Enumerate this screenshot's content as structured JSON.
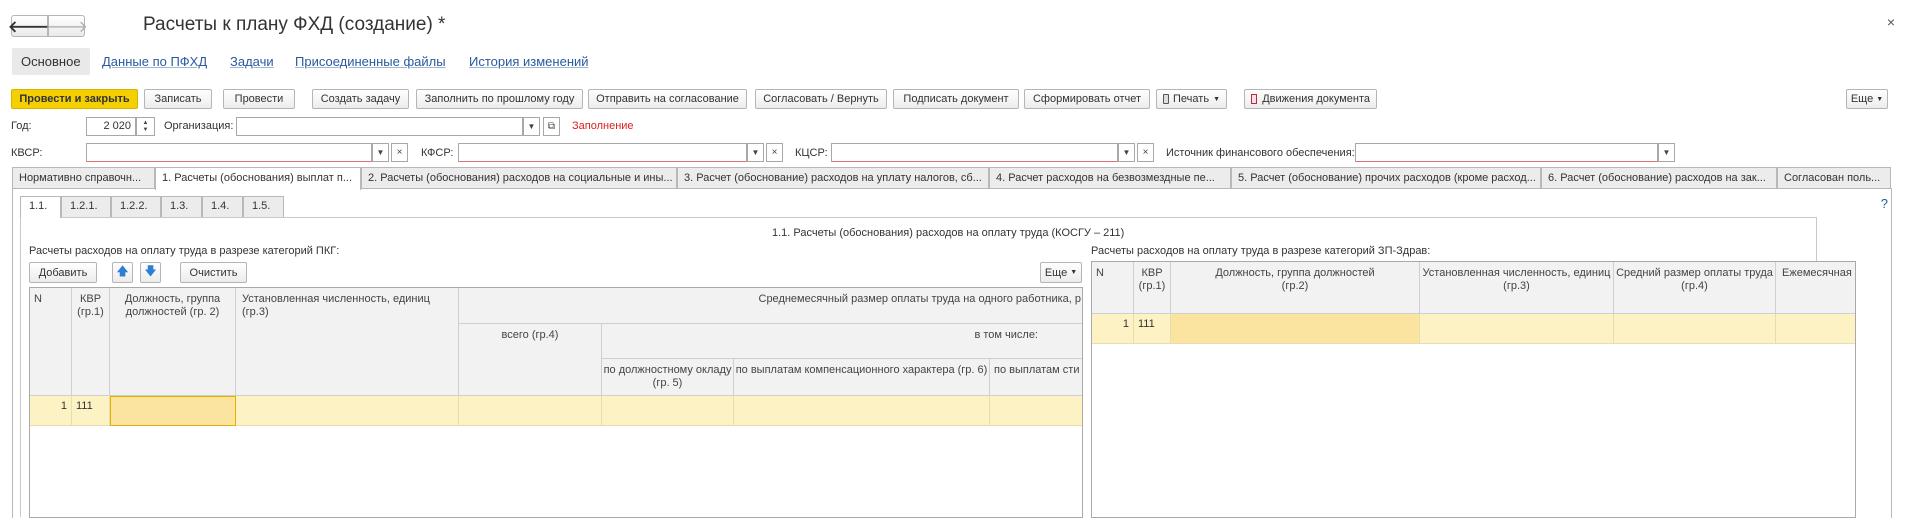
{
  "window": {
    "title": "Расчеты к плану ФХД (создание) *",
    "close_glyph": "×",
    "back_glyph": "🡐",
    "forward_glyph": "🡒"
  },
  "sections": [
    "Основное",
    "Данные по ПФХД",
    "Задачи",
    "Присоединенные файлы",
    "История изменений"
  ],
  "toolbar": {
    "post_close": "Провести и закрыть",
    "save": "Записать",
    "post": "Провести",
    "create_task": "Создать задачу",
    "fill_last_year": "Заполнить по прошлому году",
    "send_approval": "Отправить на согласование",
    "approve_return": "Согласовать / Вернуть",
    "sign": "Подписать документ",
    "report": "Сформировать отчет",
    "print": "Печать",
    "movements": "Движения документа",
    "more": "Еще"
  },
  "form": {
    "year_label": "Год:",
    "year_value": "2 020",
    "org_label": "Организация:",
    "org_value": "",
    "fill_warning": "Заполнение",
    "kvsr_label": "КВСР:",
    "kfsr_label": "КФСР:",
    "kcsr_label": "КЦСР:",
    "source_label": "Источник финансового обеспечения:"
  },
  "tabs": [
    "Нормативно справочн...",
    "1. Расчеты (обоснования) выплат п...",
    "2. Расчеты (обоснования) расходов на социальные и ины...",
    "3. Расчет (обоснование) расходов на уплату налогов, сб...",
    "4. Расчет расходов на безвозмездные пе...",
    "5. Расчет (обоснование) прочих расходов (кроме расход...",
    "6. Расчет (обоснование) расходов на зак...",
    "Согласован поль..."
  ],
  "subtabs": [
    "1.1.",
    "1.2.1.",
    "1.2.2.",
    "1.3.",
    "1.4.",
    "1.5."
  ],
  "help": "?",
  "section_title": "1.1. Расчеты (обоснования) расходов на оплату труда (КОСГУ – 211)",
  "left": {
    "title": "Расчеты расходов на оплату труда в разрезе категорий ПКГ:",
    "add": "Добавить",
    "clear": "Очистить",
    "more": "Еще",
    "headers": {
      "n": "N",
      "kvr": "КВР (гр.1)",
      "position": "Должность, группа должностей (гр. 2)",
      "headcount": "Установленная численность, единиц (гр.3)",
      "avg_salary": "Среднемесячный размер оплаты труда на одного работника, р",
      "total": "всего (гр.4)",
      "incl": "в том числе:",
      "by_salary": "по должностному окладу (гр. 5)",
      "compensation": "по выплатам  компенсационного характера (гр. 6)",
      "stim": "по выплатам  сти"
    },
    "rows": [
      {
        "n": "1",
        "kvr": "111"
      }
    ]
  },
  "right": {
    "title": "Расчеты расходов на оплату труда в разрезе категорий ЗП-Здрав:",
    "headers": {
      "n": "N",
      "kvr": "КВР (гр.1)",
      "position": "Должность, группа должностей (гр.2)",
      "headcount": "Установленная численность, единиц (гр.3)",
      "avg": "Средний размер оплаты труда (гр.4)",
      "monthly": "Ежемесячная на"
    },
    "rows": [
      {
        "n": "1",
        "kvr": "111"
      }
    ]
  }
}
